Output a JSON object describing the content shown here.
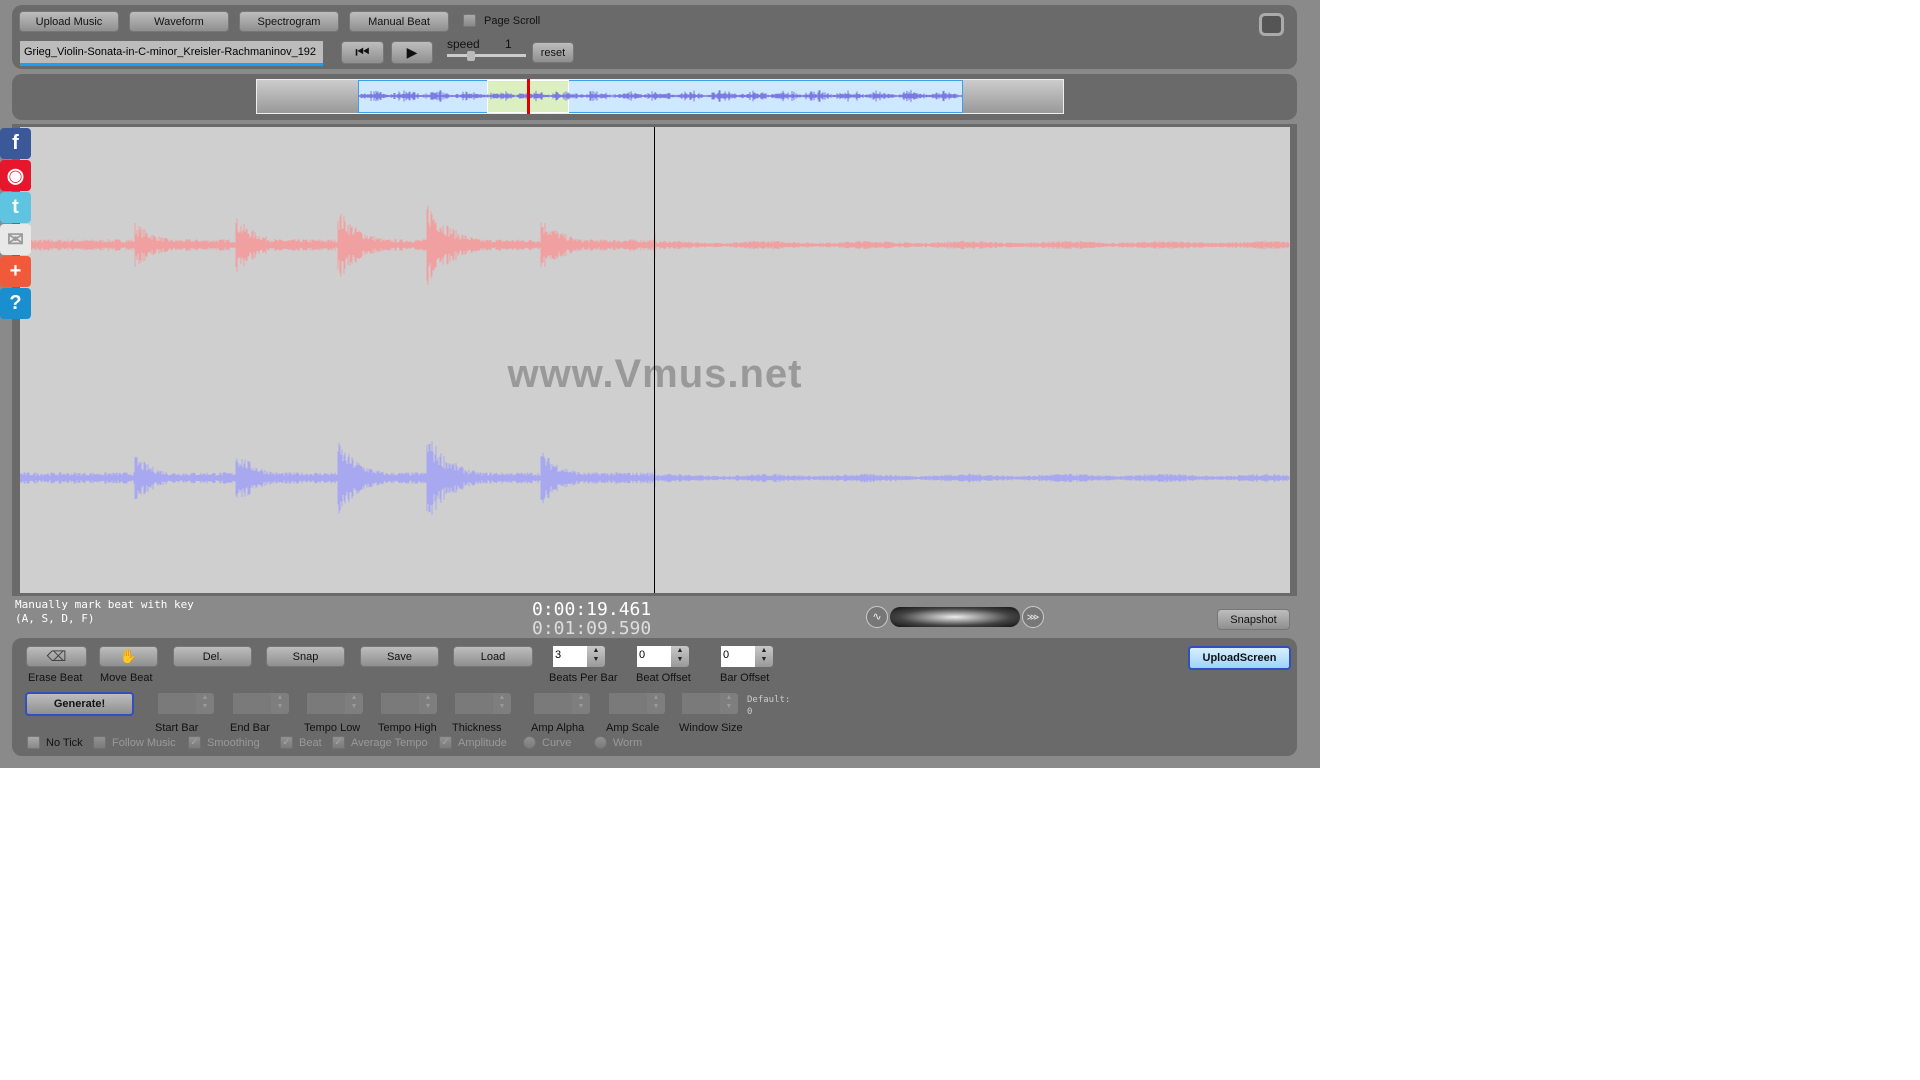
{
  "toolbar": {
    "upload_music": "Upload Music",
    "waveform": "Waveform",
    "spectrogram": "Spectrogram",
    "manual_beat": "Manual Beat",
    "page_scroll": "Page Scroll",
    "page_scroll_checked": false,
    "file_name": "Grieg_Violin-Sonata-in-C-minor_Kreisler-Rachmaninov_192",
    "speed_label": "speed",
    "speed_value": "1",
    "reset": "reset"
  },
  "watermark": "www.Vmus.net",
  "status": {
    "line1": "Manually mark beat with key",
    "line2": "(A, S, D, F)",
    "current_time": "0:00:19.461",
    "total_time": "0:01:09.590",
    "snapshot": "Snapshot"
  },
  "beat": {
    "erase": "Erase Beat",
    "move": "Move Beat",
    "del": "Del.",
    "snap": "Snap",
    "save": "Save",
    "load": "Load",
    "upload_screen": "UploadScreen",
    "generate": "Generate!",
    "spinners": [
      {
        "label": "Beats Per Bar",
        "value": "3"
      },
      {
        "label": "Beat Offset",
        "value": "0"
      },
      {
        "label": "Bar Offset",
        "value": "0"
      }
    ],
    "params": [
      "Start Bar",
      "End Bar",
      "Tempo Low",
      "Tempo High",
      "Thickness",
      "Amp Alpha",
      "Amp Scale",
      "Window Size"
    ],
    "default_label": "Default:",
    "default_value": "0",
    "options": [
      {
        "label": "No Tick",
        "type": "checkbox",
        "checked": false
      },
      {
        "label": "Follow Music",
        "type": "checkbox",
        "checked": false
      },
      {
        "label": "Smoothing",
        "type": "checkbox",
        "checked": true
      },
      {
        "label": "Beat",
        "type": "checkbox",
        "checked": true
      },
      {
        "label": "Average Tempo",
        "type": "checkbox",
        "checked": true
      },
      {
        "label": "Amplitude",
        "type": "checkbox",
        "checked": true
      },
      {
        "label": "Curve",
        "type": "radio",
        "checked": false
      },
      {
        "label": "Worm",
        "type": "radio",
        "checked": false
      }
    ]
  },
  "social": [
    {
      "icon": "facebook-icon",
      "glyph": "f",
      "color": "#3b5998"
    },
    {
      "icon": "weibo-icon",
      "glyph": "◉",
      "color": "#e6162d"
    },
    {
      "icon": "twitter-icon",
      "glyph": "t",
      "color": "#5fc4e0"
    },
    {
      "icon": "email-icon",
      "glyph": "✉",
      "color": "#e8e8e8"
    },
    {
      "icon": "share-plus-icon",
      "glyph": "+",
      "color": "#f05a3a"
    },
    {
      "icon": "help-icon",
      "glyph": "?",
      "color": "#1a8fd0"
    }
  ],
  "colors": {
    "left_channel": "#f0a0a0",
    "right_channel": "#a8a8f0",
    "cursor": "#000000",
    "overview_bg": "#cde8ff",
    "overview_window": "#dcefc0",
    "playhead": "#e00000"
  }
}
